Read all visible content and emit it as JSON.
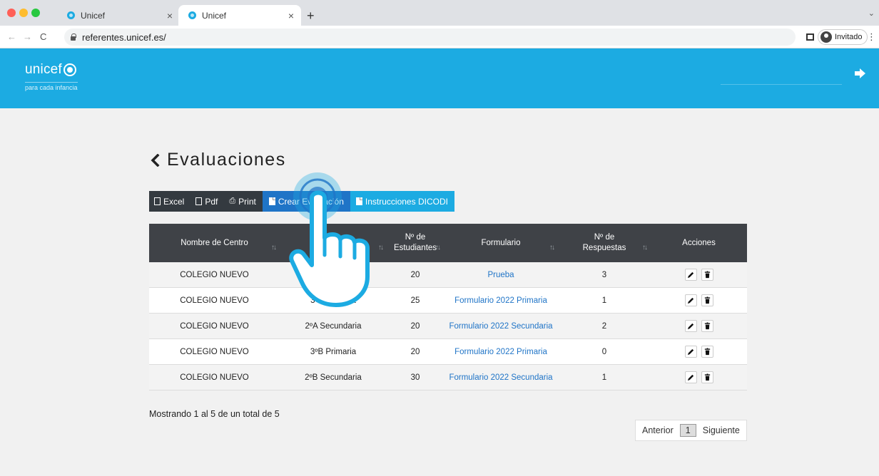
{
  "browser": {
    "tabs": [
      {
        "title": "Unicef",
        "active": false
      },
      {
        "title": "Unicef",
        "active": true
      }
    ],
    "url": "referentes.unicef.es/",
    "profile_label": "Invitado",
    "icons": [
      "back-arrow-icon",
      "forward-arrow-icon",
      "reload-icon",
      "lock-icon",
      "side-panel-icon",
      "guest-avatar-icon",
      "kebab-menu-icon"
    ]
  },
  "header": {
    "logo_text": "unicef",
    "tagline": "para cada infancia",
    "brand_color": "#1cabe2",
    "logout_icon": "logout-icon"
  },
  "page": {
    "title": "Evaluaciones"
  },
  "toolbar": {
    "excel": "Excel",
    "pdf": "Pdf",
    "print": "Print",
    "create": "Crear Evaluación",
    "instructions": "Instrucciones DICODI"
  },
  "table": {
    "headers": [
      "Nombre de Centro",
      "Grupo",
      "Nº de Estudiantes",
      "Formulario",
      "Nº de Respuestas",
      "Acciones"
    ],
    "rows": [
      {
        "centro": "COLEGIO NUEVO",
        "grupo": "",
        "estudiantes": "20",
        "formulario": "Prueba",
        "respuestas": "3"
      },
      {
        "centro": "COLEGIO NUEVO",
        "grupo": "3ºA Primaria",
        "estudiantes": "25",
        "formulario": "Formulario 2022 Primaria",
        "respuestas": "1"
      },
      {
        "centro": "COLEGIO NUEVO",
        "grupo": "2ºA Secundaria",
        "estudiantes": "20",
        "formulario": "Formulario 2022 Secundaria",
        "respuestas": "2"
      },
      {
        "centro": "COLEGIO NUEVO",
        "grupo": "3ºB Primaria",
        "estudiantes": "20",
        "formulario": "Formulario 2022 Primaria",
        "respuestas": "0"
      },
      {
        "centro": "COLEGIO NUEVO",
        "grupo": "2ºB Secundaria",
        "estudiantes": "30",
        "formulario": "Formulario 2022 Secundaria",
        "respuestas": "1"
      }
    ],
    "action_icons": [
      "pencil-icon",
      "trash-icon"
    ]
  },
  "footer": {
    "info": "Mostrando 1 al 5 de un total de 5",
    "prev": "Anterior",
    "current_page": "1",
    "next": "Siguiente"
  }
}
